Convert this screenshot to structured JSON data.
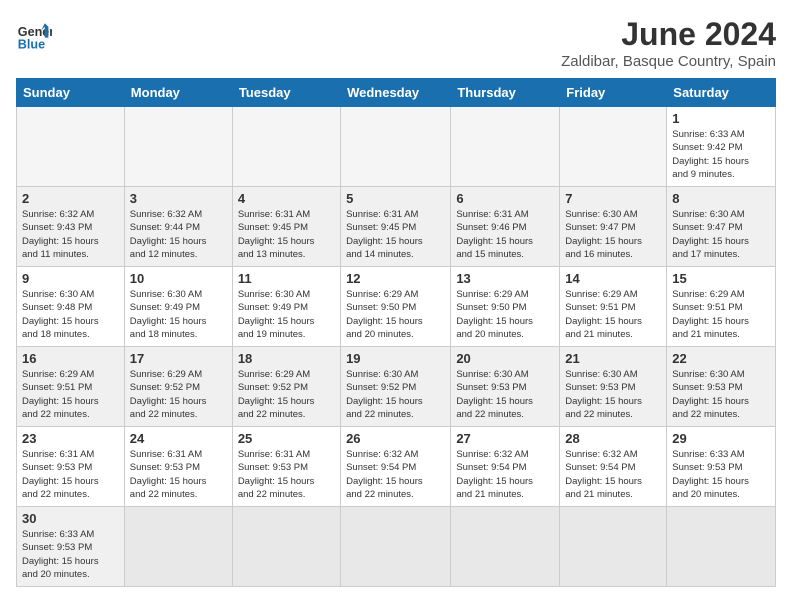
{
  "header": {
    "logo_general": "General",
    "logo_blue": "Blue",
    "month_year": "June 2024",
    "location": "Zaldibar, Basque Country, Spain"
  },
  "days_of_week": [
    "Sunday",
    "Monday",
    "Tuesday",
    "Wednesday",
    "Thursday",
    "Friday",
    "Saturday"
  ],
  "weeks": [
    [
      {
        "day": "",
        "info": ""
      },
      {
        "day": "",
        "info": ""
      },
      {
        "day": "",
        "info": ""
      },
      {
        "day": "",
        "info": ""
      },
      {
        "day": "",
        "info": ""
      },
      {
        "day": "",
        "info": ""
      },
      {
        "day": "1",
        "info": "Sunrise: 6:33 AM\nSunset: 9:42 PM\nDaylight: 15 hours\nand 9 minutes."
      }
    ],
    [
      {
        "day": "2",
        "info": "Sunrise: 6:32 AM\nSunset: 9:43 PM\nDaylight: 15 hours\nand 11 minutes."
      },
      {
        "day": "3",
        "info": "Sunrise: 6:32 AM\nSunset: 9:44 PM\nDaylight: 15 hours\nand 12 minutes."
      },
      {
        "day": "4",
        "info": "Sunrise: 6:31 AM\nSunset: 9:45 PM\nDaylight: 15 hours\nand 13 minutes."
      },
      {
        "day": "5",
        "info": "Sunrise: 6:31 AM\nSunset: 9:45 PM\nDaylight: 15 hours\nand 14 minutes."
      },
      {
        "day": "6",
        "info": "Sunrise: 6:31 AM\nSunset: 9:46 PM\nDaylight: 15 hours\nand 15 minutes."
      },
      {
        "day": "7",
        "info": "Sunrise: 6:30 AM\nSunset: 9:47 PM\nDaylight: 15 hours\nand 16 minutes."
      },
      {
        "day": "8",
        "info": "Sunrise: 6:30 AM\nSunset: 9:47 PM\nDaylight: 15 hours\nand 17 minutes."
      }
    ],
    [
      {
        "day": "9",
        "info": "Sunrise: 6:30 AM\nSunset: 9:48 PM\nDaylight: 15 hours\nand 18 minutes."
      },
      {
        "day": "10",
        "info": "Sunrise: 6:30 AM\nSunset: 9:49 PM\nDaylight: 15 hours\nand 18 minutes."
      },
      {
        "day": "11",
        "info": "Sunrise: 6:30 AM\nSunset: 9:49 PM\nDaylight: 15 hours\nand 19 minutes."
      },
      {
        "day": "12",
        "info": "Sunrise: 6:29 AM\nSunset: 9:50 PM\nDaylight: 15 hours\nand 20 minutes."
      },
      {
        "day": "13",
        "info": "Sunrise: 6:29 AM\nSunset: 9:50 PM\nDaylight: 15 hours\nand 20 minutes."
      },
      {
        "day": "14",
        "info": "Sunrise: 6:29 AM\nSunset: 9:51 PM\nDaylight: 15 hours\nand 21 minutes."
      },
      {
        "day": "15",
        "info": "Sunrise: 6:29 AM\nSunset: 9:51 PM\nDaylight: 15 hours\nand 21 minutes."
      }
    ],
    [
      {
        "day": "16",
        "info": "Sunrise: 6:29 AM\nSunset: 9:51 PM\nDaylight: 15 hours\nand 22 minutes."
      },
      {
        "day": "17",
        "info": "Sunrise: 6:29 AM\nSunset: 9:52 PM\nDaylight: 15 hours\nand 22 minutes."
      },
      {
        "day": "18",
        "info": "Sunrise: 6:29 AM\nSunset: 9:52 PM\nDaylight: 15 hours\nand 22 minutes."
      },
      {
        "day": "19",
        "info": "Sunrise: 6:30 AM\nSunset: 9:52 PM\nDaylight: 15 hours\nand 22 minutes."
      },
      {
        "day": "20",
        "info": "Sunrise: 6:30 AM\nSunset: 9:53 PM\nDaylight: 15 hours\nand 22 minutes."
      },
      {
        "day": "21",
        "info": "Sunrise: 6:30 AM\nSunset: 9:53 PM\nDaylight: 15 hours\nand 22 minutes."
      },
      {
        "day": "22",
        "info": "Sunrise: 6:30 AM\nSunset: 9:53 PM\nDaylight: 15 hours\nand 22 minutes."
      }
    ],
    [
      {
        "day": "23",
        "info": "Sunrise: 6:31 AM\nSunset: 9:53 PM\nDaylight: 15 hours\nand 22 minutes."
      },
      {
        "day": "24",
        "info": "Sunrise: 6:31 AM\nSunset: 9:53 PM\nDaylight: 15 hours\nand 22 minutes."
      },
      {
        "day": "25",
        "info": "Sunrise: 6:31 AM\nSunset: 9:53 PM\nDaylight: 15 hours\nand 22 minutes."
      },
      {
        "day": "26",
        "info": "Sunrise: 6:32 AM\nSunset: 9:54 PM\nDaylight: 15 hours\nand 22 minutes."
      },
      {
        "day": "27",
        "info": "Sunrise: 6:32 AM\nSunset: 9:54 PM\nDaylight: 15 hours\nand 21 minutes."
      },
      {
        "day": "28",
        "info": "Sunrise: 6:32 AM\nSunset: 9:54 PM\nDaylight: 15 hours\nand 21 minutes."
      },
      {
        "day": "29",
        "info": "Sunrise: 6:33 AM\nSunset: 9:53 PM\nDaylight: 15 hours\nand 20 minutes."
      }
    ],
    [
      {
        "day": "30",
        "info": "Sunrise: 6:33 AM\nSunset: 9:53 PM\nDaylight: 15 hours\nand 20 minutes."
      },
      {
        "day": "",
        "info": ""
      },
      {
        "day": "",
        "info": ""
      },
      {
        "day": "",
        "info": ""
      },
      {
        "day": "",
        "info": ""
      },
      {
        "day": "",
        "info": ""
      },
      {
        "day": "",
        "info": ""
      }
    ]
  ]
}
